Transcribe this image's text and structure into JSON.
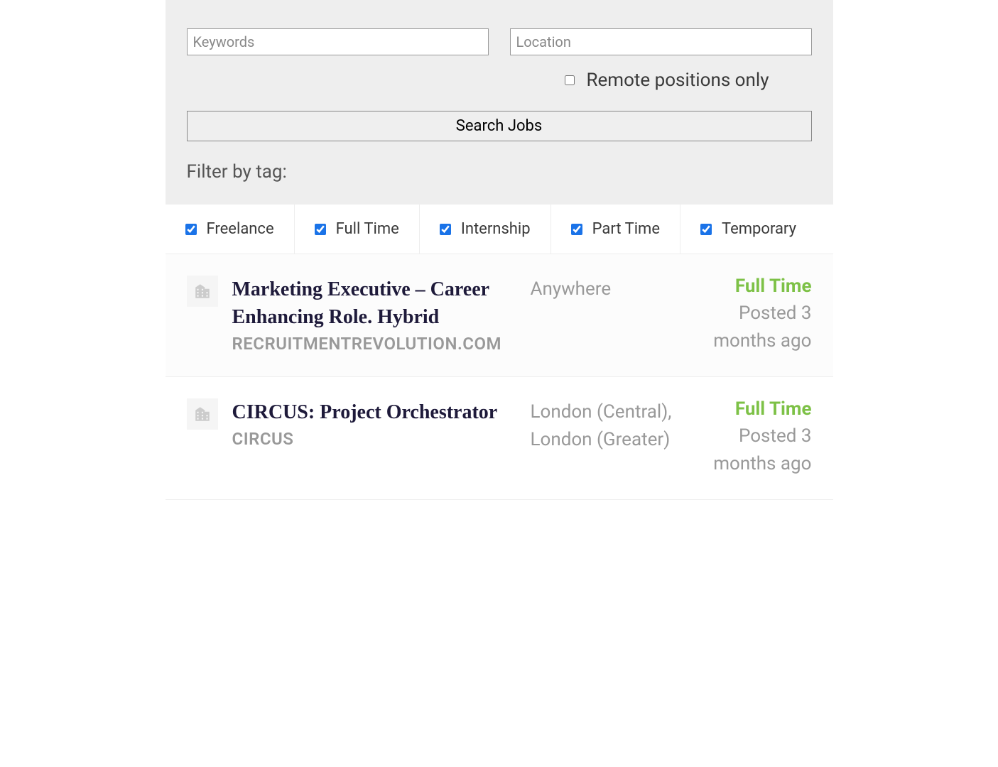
{
  "search": {
    "keywords_placeholder": "Keywords",
    "location_placeholder": "Location",
    "remote_label": "Remote positions only",
    "remote_checked": false,
    "button_label": "Search Jobs"
  },
  "filter": {
    "heading": "Filter by tag:",
    "tags": [
      {
        "label": "Freelance",
        "checked": true
      },
      {
        "label": "Full Time",
        "checked": true
      },
      {
        "label": "Internship",
        "checked": true
      },
      {
        "label": "Part Time",
        "checked": true
      },
      {
        "label": "Temporary",
        "checked": true
      }
    ]
  },
  "jobs": [
    {
      "title": "Marketing Executive – Career Enhancing Role. Hybrid",
      "company": "RECRUITMENTREVOLUTION.COM",
      "location": "Anywhere",
      "type": "Full Time",
      "posted": "Posted 3 months ago"
    },
    {
      "title": "CIRCUS: Project Orchestrator",
      "company": "CIRCUS",
      "location": "London (Central), London (Greater)",
      "type": "Full Time",
      "posted": "Posted 3 months ago"
    }
  ]
}
